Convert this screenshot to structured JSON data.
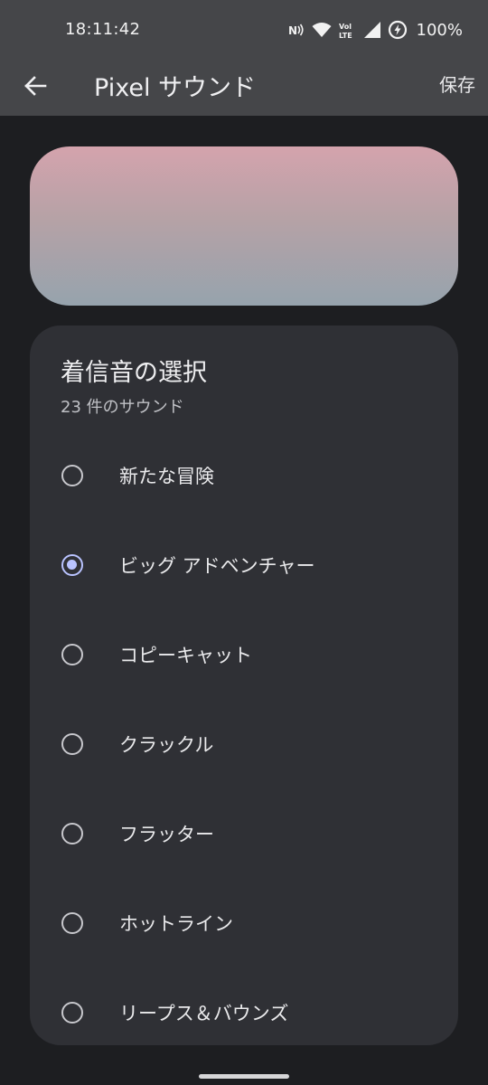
{
  "status_bar": {
    "time": "18:11:42",
    "battery": "100%",
    "icons": [
      "nfc-icon",
      "wifi-icon",
      "volte-icon",
      "signal-icon",
      "battery-saver-icon"
    ]
  },
  "app_bar": {
    "back_icon": "arrow-back-icon",
    "title": "Pixel サウンド",
    "save_label": "保存"
  },
  "hero": {
    "gradient_colors": [
      "#d4a3ad",
      "#96a3ad"
    ]
  },
  "ringtone_list": {
    "title": "着信音の選択",
    "count_label": "23 件のサウンド",
    "selected_index": 1,
    "accent_color": "#b9c3ff",
    "options": [
      {
        "label": "新たな冒険"
      },
      {
        "label": "ビッグ アドベンチャー"
      },
      {
        "label": "コピーキャット"
      },
      {
        "label": "クラックル"
      },
      {
        "label": "フラッター"
      },
      {
        "label": "ホットライン"
      },
      {
        "label": "リープス＆バウンズ"
      }
    ]
  }
}
